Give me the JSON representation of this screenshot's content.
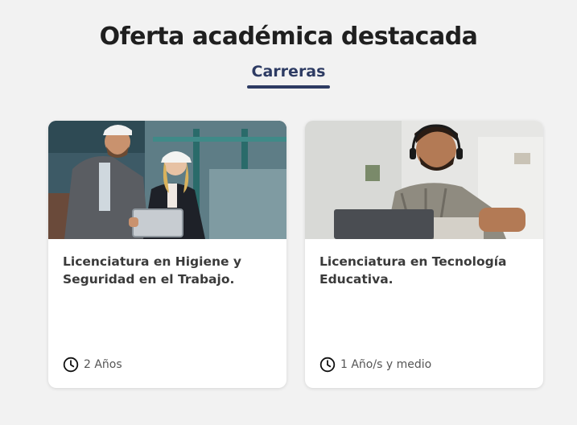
{
  "page": {
    "title": "Oferta académica destacada"
  },
  "tabs": [
    {
      "label": "Carreras",
      "active": true
    }
  ],
  "colors": {
    "accent": "#2d3b63",
    "background": "#f2f2f2",
    "card": "#ffffff"
  },
  "cards": [
    {
      "title": "Licenciatura en Higiene y Seguridad en el Trabajo.",
      "duration": "2 Años",
      "duration_icon": "clock-icon",
      "image": "industrial-workers-with-tablet"
    },
    {
      "title": "Licenciatura en Tecnología Educativa.",
      "duration": "1 Año/s y medio",
      "duration_icon": "clock-icon",
      "image": "man-with-headset-at-laptop"
    }
  ]
}
